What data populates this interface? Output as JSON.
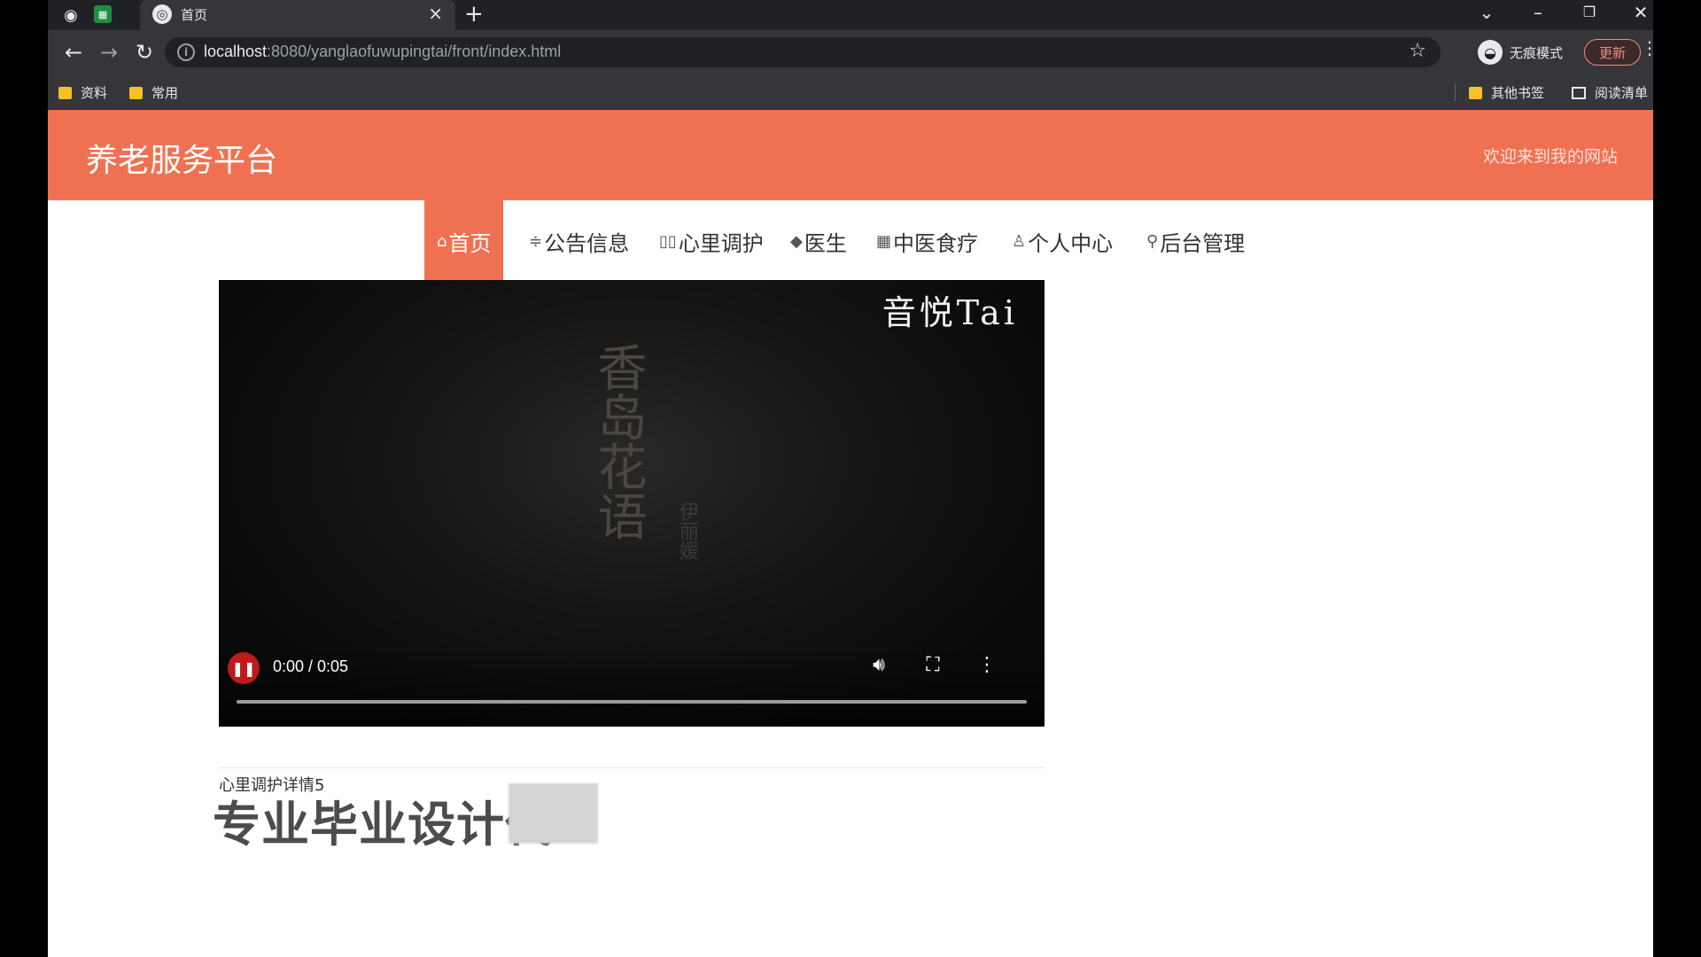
{
  "browser": {
    "tab_title": "首页",
    "url_host": "localhost",
    "url_path": ":8080/yanglaofuwupingtai/front/index.html",
    "incognito_label": "无痕模式",
    "update_label": "更新",
    "bookmarks": [
      "资料",
      "常用"
    ],
    "bookmarks_right": [
      "其他书签",
      "阅读清单"
    ]
  },
  "site": {
    "title": "养老服务平台",
    "welcome": "欢迎来到我的网站",
    "nav": [
      {
        "icon": "⌂",
        "label": "首页",
        "active": true
      },
      {
        "icon": "≑",
        "label": "公告信息"
      },
      {
        "icon": "▯▯",
        "label": "心里调护"
      },
      {
        "icon": "◆",
        "label": "医生"
      },
      {
        "icon": "▦",
        "label": "中医食疗"
      },
      {
        "icon": "♙",
        "label": "个人中心"
      },
      {
        "icon": "⚲",
        "label": "后台管理"
      }
    ]
  },
  "video": {
    "watermark": "音悦Tai",
    "poem_text": "香岛花语",
    "poem_sub": "伊丽媛",
    "time": "0:00 / 0:05",
    "progress": 0.0
  },
  "detail": {
    "caption": "心里调护详情5",
    "overlay": "专业毕业设计代"
  }
}
